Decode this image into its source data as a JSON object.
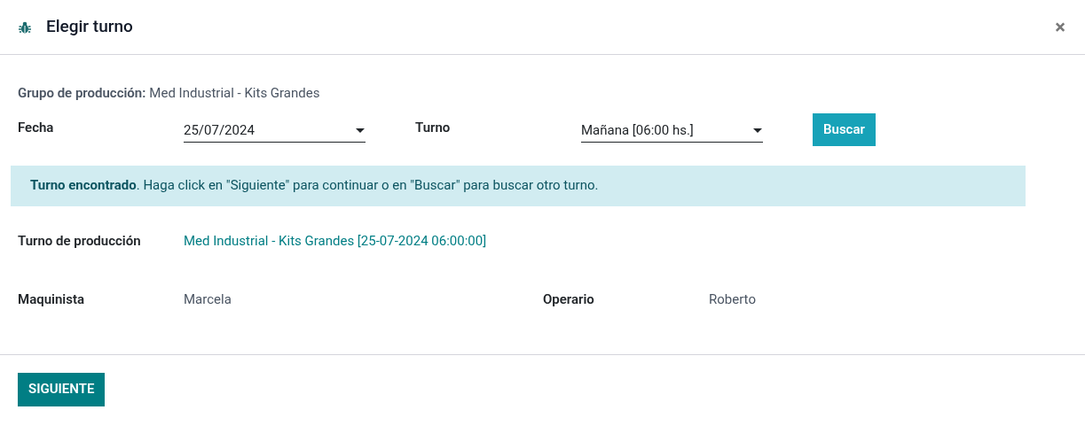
{
  "dialog": {
    "title": "Elegir turno",
    "close": "×"
  },
  "group": {
    "label": "Grupo de producción:",
    "value": "Med Industrial - Kits Grandes"
  },
  "filters": [
    {
      "label": "Fecha",
      "value": "25/07/2024"
    },
    {
      "label": "Turno",
      "value": "Mañana [06:00 hs.]"
    }
  ],
  "search_button": "Buscar",
  "alert": "**Turno encontrado**. Haga click en \"Siguiente\" para continuar o en \"Buscar\" para buscar otro turno.",
  "production_shift": {
    "label": "Turno de producción",
    "value": "Med Industrial - Kits Grandes [25-07-2024 06:00:00]"
  },
  "people": [
    {
      "label": "Maquinista",
      "value": "Marcela"
    },
    {
      "label": "Operario",
      "value": "Roberto"
    }
  ],
  "footer_button": "SIGUIENTE"
}
